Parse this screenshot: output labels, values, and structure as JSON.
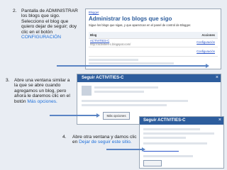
{
  "steps": [
    {
      "number": "2.",
      "text": "Pantalla de ADMINISTRAR los blogs que sigo. Selecciono el blog que quiero dejar de seguir; doy clic en el botón ",
      "highlight": "CONFIGURACIÓN"
    },
    {
      "number": "3.",
      "text": "Abre una ventana similar a la que se abre cuando agregamos un blog, pero ahora le daremos clic en el botón ",
      "highlight": "Más opciones."
    },
    {
      "number": "4.",
      "text": "Abre otra ventana y damos clic en ",
      "highlight": "Dejar de seguir este sitio."
    }
  ],
  "screenshot1": {
    "top_link": "Blogger",
    "heading": "Administrar los blogs que sigo",
    "intro": "Sigue los blogs que sigas, y que aparezcan en el panel de control de Blogger.",
    "col_blog": "Blog",
    "col_action": "Acciones",
    "blogs": [
      {
        "name": "ACTIVITIES-C",
        "url": "http://activities-c.blogspot.com/",
        "actions": "Configuración"
      },
      {
        "name": "",
        "url": "",
        "actions": "Configuración"
      }
    ]
  },
  "screenshot2": {
    "title": "Seguir ACTIVITIES-C",
    "button": "Más opciones"
  },
  "screenshot3": {
    "title": "Seguir ACTIVITIES-C"
  }
}
